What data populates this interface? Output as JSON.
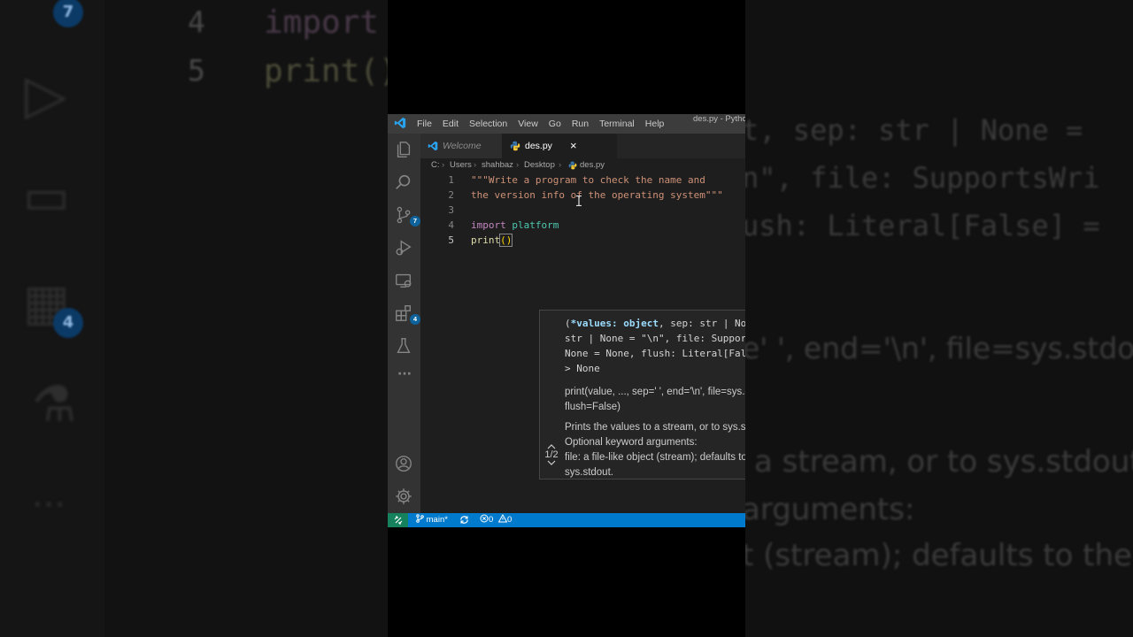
{
  "background": {
    "badges": [
      "7",
      "4"
    ],
    "line_numbers": [
      "4",
      "5"
    ],
    "code_import": "import",
    "code_print": "print()",
    "right_text": [
      "t, sep: str | None =",
      "n\", file: SupportsWri",
      "ush: Literal[False] =",
      "e' ', end='\\n', file=sys.stdo",
      "a stream, or to sys.stdout",
      "arguments:",
      "t (stream); defaults to the"
    ]
  },
  "window": {
    "title": "des.py - Pytho",
    "menu": [
      "File",
      "Edit",
      "Selection",
      "View",
      "Go",
      "Run",
      "Terminal",
      "Help"
    ]
  },
  "activity_bar": {
    "source_control_badge": "7",
    "extensions_badge": "4",
    "more": "···"
  },
  "tabs": [
    {
      "label": "Welcome",
      "active": false
    },
    {
      "label": "des.py",
      "active": true,
      "close": "×"
    }
  ],
  "breadcrumb": [
    "C:",
    "Users",
    "shahbaz",
    "Desktop",
    "des.py"
  ],
  "breadcrumb_sep": "›",
  "editor": {
    "line_numbers": [
      "1",
      "2",
      "3",
      "4",
      "5"
    ],
    "line1": "\"\"\"Write a program to check the name and",
    "line2": "the version info of the operating system\"\"\"",
    "line4_kw": "import",
    "line4_mod": "platform",
    "line5_fn": "print",
    "line5_paren": "()"
  },
  "hover": {
    "sig_open": "(",
    "sig_first": "*values: object",
    "sig_rest1": ", sep: str | None =",
    "sig_line2": "str | None = \"\\n\", file: SupportsWri",
    "sig_line3": "None = None, flush: Literal[False] =",
    "sig_line4": "> None",
    "doc_sig1": "print(value, ..., sep=' ', end='\\n', file=sys.stdo",
    "doc_sig2": "flush=False)",
    "doc1": "Prints the values to a stream, or to sys.stdout",
    "doc2": "Optional keyword arguments:",
    "doc3": "file: a file-like object (stream); defaults to the",
    "doc4": "sys.stdout.",
    "page": "1/2"
  },
  "status": {
    "branch": "main*",
    "errors": "0",
    "warnings": "0"
  },
  "colors": {
    "accent": "#007acc",
    "remote": "#16825d",
    "string": "#ce9178",
    "keyword": "#c586c0",
    "module": "#4ec9b0",
    "function": "#dcdcaa"
  }
}
